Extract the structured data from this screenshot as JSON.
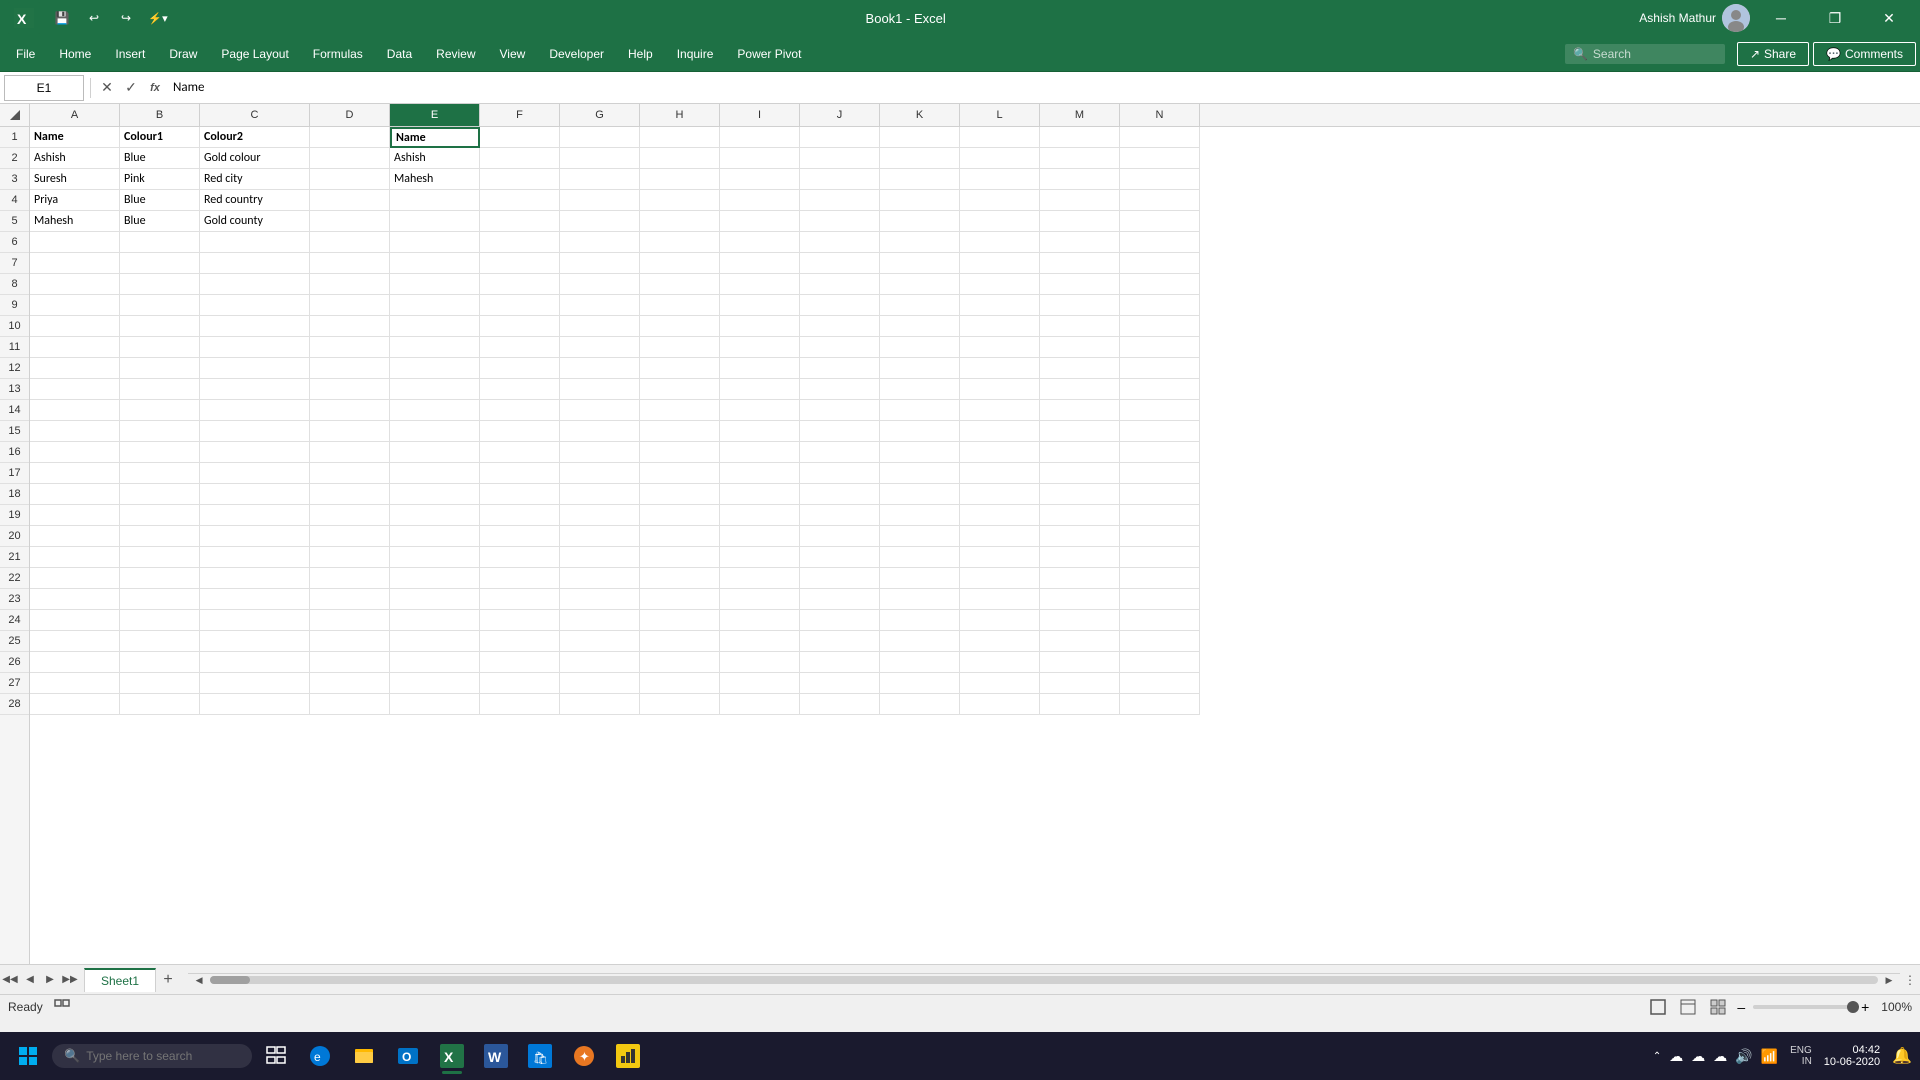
{
  "title_bar": {
    "title": "Book1  -  Excel",
    "user": "Ashish Mathur",
    "minimize": "─",
    "restore": "❐",
    "close": "✕",
    "quick_access": [
      "💾",
      "↩",
      "↪"
    ]
  },
  "menu": {
    "items": [
      "File",
      "Home",
      "Insert",
      "Draw",
      "Page Layout",
      "Formulas",
      "Data",
      "Review",
      "View",
      "Developer",
      "Help",
      "Inquire",
      "Power Pivot"
    ],
    "search_placeholder": "Search",
    "share_label": "Share",
    "comments_label": "Comments"
  },
  "formula_bar": {
    "name_box": "E1",
    "formula_content": "Name",
    "icons": [
      "✕",
      "✓",
      "fx"
    ]
  },
  "columns": {
    "letters": [
      "A",
      "B",
      "C",
      "D",
      "E",
      "F",
      "G",
      "H",
      "I",
      "J",
      "K",
      "L",
      "M",
      "N"
    ],
    "selected": "E"
  },
  "rows": {
    "count": 28,
    "selected": null
  },
  "cells": {
    "data": {
      "A1": {
        "value": "Name",
        "bold": true
      },
      "B1": {
        "value": "Colour1",
        "bold": true
      },
      "C1": {
        "value": "Colour2",
        "bold": true
      },
      "D1": {
        "value": "",
        "bold": false
      },
      "E1": {
        "value": "Name",
        "bold": true,
        "selected": true
      },
      "A2": {
        "value": "Ashish"
      },
      "B2": {
        "value": "Blue"
      },
      "C2": {
        "value": "Gold colour"
      },
      "E2": {
        "value": "Ashish"
      },
      "A3": {
        "value": "Suresh"
      },
      "B3": {
        "value": "Pink"
      },
      "C3": {
        "value": "Red city"
      },
      "E3": {
        "value": "Mahesh"
      },
      "A4": {
        "value": "Priya"
      },
      "B4": {
        "value": "Blue"
      },
      "C4": {
        "value": "Red country"
      },
      "A5": {
        "value": "Mahesh"
      },
      "B5": {
        "value": "Blue"
      },
      "C5": {
        "value": "Gold county"
      }
    }
  },
  "sheet_tabs": {
    "sheets": [
      "Sheet1"
    ],
    "active": "Sheet1"
  },
  "status_bar": {
    "ready": "Ready",
    "zoom": "100%"
  },
  "taskbar": {
    "time": "04:42",
    "date": "10-06-2020",
    "language": "ENG",
    "region": "IN"
  }
}
